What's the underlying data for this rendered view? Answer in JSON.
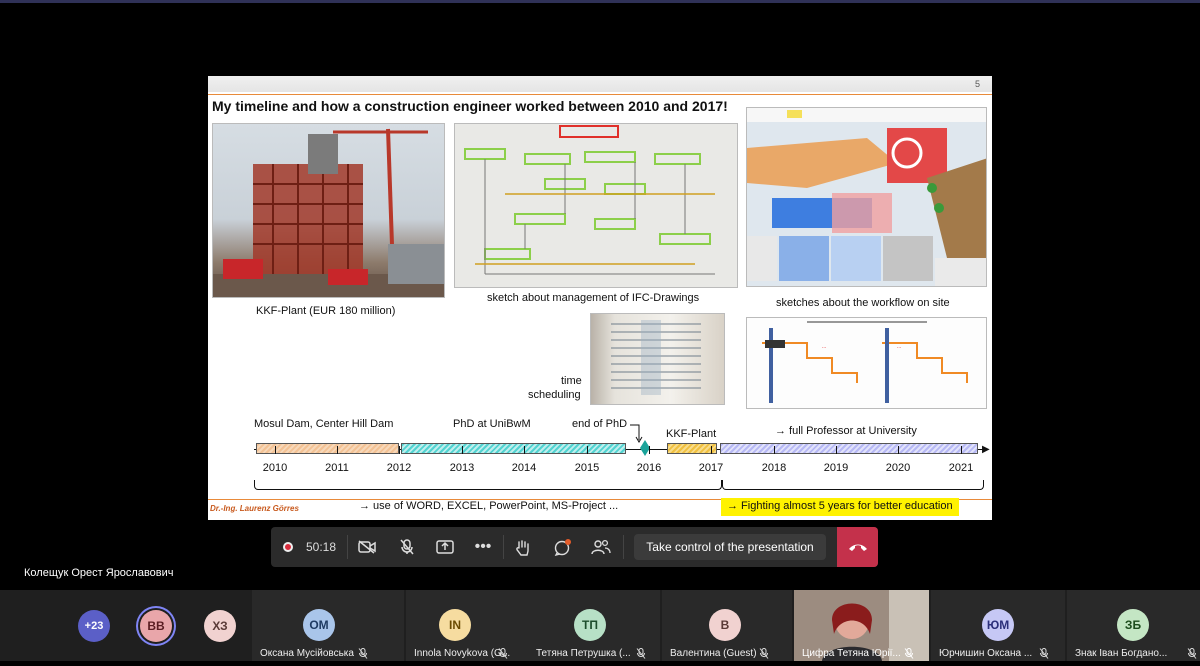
{
  "slide": {
    "page_number": "5",
    "title": "My timeline and how a construction engineer worked between 2010 and 2017!",
    "captions": {
      "kkf_plant": "KKF-Plant (EUR 180 million)",
      "ifc_sketch": "sketch about management of IFC-Drawings",
      "workflow": "sketches about the workflow on site",
      "time_sched_1": "time",
      "time_sched_2": "scheduling"
    },
    "timeline": {
      "labels": {
        "mosul": "Mosul Dam, Center Hill Dam",
        "phd": "PhD at UniBwM",
        "end_phd": "end of PhD",
        "kkf": "KKF-Plant",
        "professor": "→ full Professor at University"
      },
      "years": [
        "2010",
        "2011",
        "2012",
        "2013",
        "2014",
        "2015",
        "2016",
        "2017",
        "2018",
        "2019",
        "2020",
        "2021"
      ]
    },
    "author": "Dr.-Ing. Laurenz Görres",
    "use_text": "→ use of WORD, EXCEL, PowerPoint, MS-Project ...",
    "fighting_text": "→ Fighting almost 5 years for better education",
    "colors": {
      "accent": "#e88a3a",
      "highlight": "#fff200"
    }
  },
  "controls": {
    "timer": "50:18",
    "take_control": "Take control of the presentation",
    "icons": [
      "record-icon",
      "camera-off-icon",
      "mic-off-icon",
      "share-icon",
      "more-icon",
      "raise-hand-icon",
      "chat-icon",
      "people-icon",
      "hang-up-icon"
    ]
  },
  "presenter_name": "Колещук Орест Ярославович",
  "participants": {
    "overflow": "+23",
    "avatars": [
      {
        "initials": "ВВ",
        "color": "#e9a6aa"
      },
      {
        "initials": "ХЗ",
        "color": "#f1d2d0"
      }
    ],
    "tiles": [
      {
        "initials": "ОМ",
        "name": "Оксана Мусійовська",
        "color": "#a9c5ea"
      },
      {
        "initials": "IN",
        "name": "Innola Novykova (G...",
        "color": "#f6dca0"
      },
      {
        "initials": "ТП",
        "name": "Тетяна Петрушка (...",
        "color": "#b7e0c6"
      },
      {
        "initials": "В",
        "name": "Валентина (Guest)",
        "color": "#f1d2d0"
      },
      {
        "initials": "",
        "name": "Цифра Тетяна Юрії...",
        "color": "#8a7a70"
      },
      {
        "initials": "ЮМ",
        "name": "Юрчишин Оксана ...",
        "color": "#c6c8f5"
      },
      {
        "initials": "ЗБ",
        "name": "Знак Іван Богдано...",
        "color": "#c4e6c4"
      }
    ]
  }
}
